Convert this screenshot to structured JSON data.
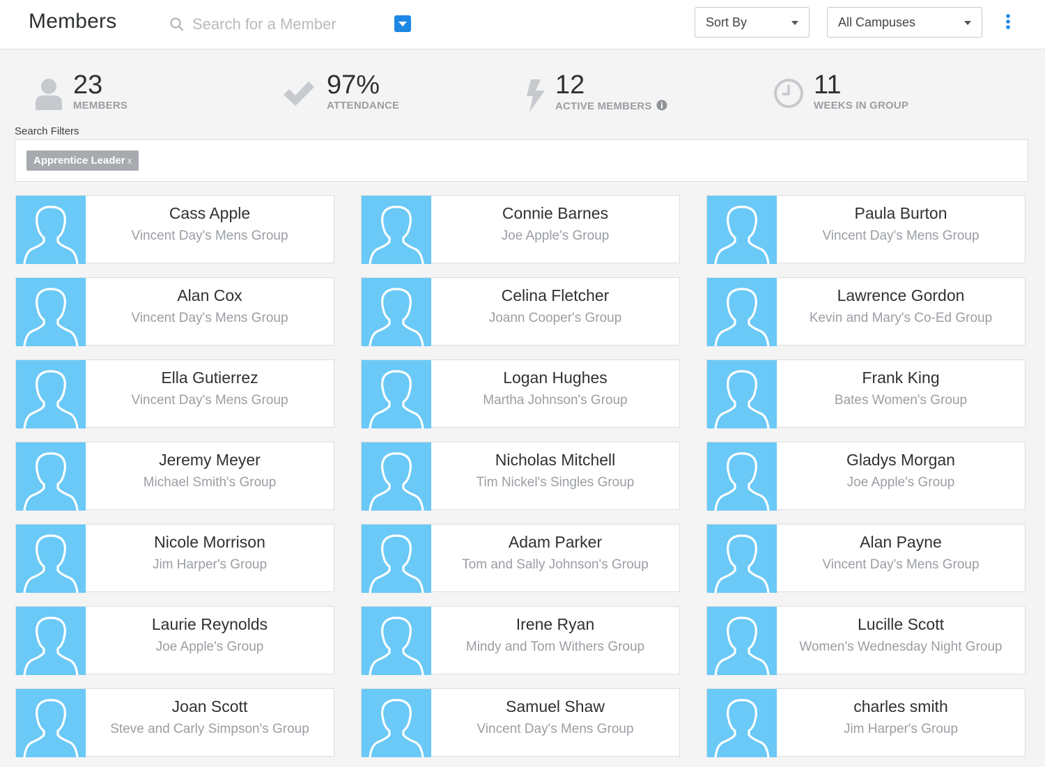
{
  "header": {
    "title": "Members",
    "search_placeholder": "Search for a Member",
    "sort_label": "Sort By",
    "campus_label": "All Campuses"
  },
  "stats": [
    {
      "value": "23",
      "caption": "MEMBERS",
      "icon": "person-icon"
    },
    {
      "value": "97%",
      "caption": "ATTENDANCE",
      "icon": "checkmark-icon"
    },
    {
      "value": "12",
      "caption": "ACTIVE MEMBERS",
      "icon": "lightning-icon"
    },
    {
      "value": "11",
      "caption": "WEEKS IN GROUP",
      "icon": "clock-icon"
    }
  ],
  "filters": {
    "label": "Search Filters",
    "chips": [
      {
        "label": "Apprentice Leader",
        "remove": "x"
      }
    ]
  },
  "members": [
    {
      "name": "Cass Apple",
      "group": "Vincent Day's Mens Group"
    },
    {
      "name": "Connie Barnes",
      "group": "Joe Apple's Group"
    },
    {
      "name": "Paula Burton",
      "group": "Vincent Day's Mens Group"
    },
    {
      "name": "Alan Cox",
      "group": "Vincent Day's Mens Group"
    },
    {
      "name": "Celina Fletcher",
      "group": "Joann Cooper's Group"
    },
    {
      "name": "Lawrence Gordon",
      "group": "Kevin and Mary's Co-Ed Group"
    },
    {
      "name": "Ella Gutierrez",
      "group": "Vincent Day's Mens Group"
    },
    {
      "name": "Logan Hughes",
      "group": "Martha Johnson's Group"
    },
    {
      "name": "Frank King",
      "group": "Bates Women's Group"
    },
    {
      "name": "Jeremy Meyer",
      "group": "Michael Smith's Group"
    },
    {
      "name": "Nicholas Mitchell",
      "group": "Tim Nickel's Singles Group"
    },
    {
      "name": "Gladys Morgan",
      "group": "Joe Apple's Group"
    },
    {
      "name": "Nicole Morrison",
      "group": "Jim Harper's Group"
    },
    {
      "name": "Adam Parker",
      "group": "Tom and Sally Johnson's Group"
    },
    {
      "name": "Alan Payne",
      "group": "Vincent Day's Mens Group"
    },
    {
      "name": "Laurie Reynolds",
      "group": "Joe Apple's Group"
    },
    {
      "name": "Irene Ryan",
      "group": "Mindy and Tom Withers Group"
    },
    {
      "name": "Lucille Scott",
      "group": "Women's Wednesday Night Group"
    },
    {
      "name": "Joan Scott",
      "group": "Steve and Carly Simpson's Group"
    },
    {
      "name": "Samuel Shaw",
      "group": "Vincent Day's Mens Group"
    },
    {
      "name": "charles smith",
      "group": "Jim Harper's Group"
    }
  ],
  "colors": {
    "accent": "#1e88e5",
    "avatar_bg": "#6ac9f6",
    "muted_text": "#9a9ea3",
    "chip_bg": "#a7aaaf"
  }
}
